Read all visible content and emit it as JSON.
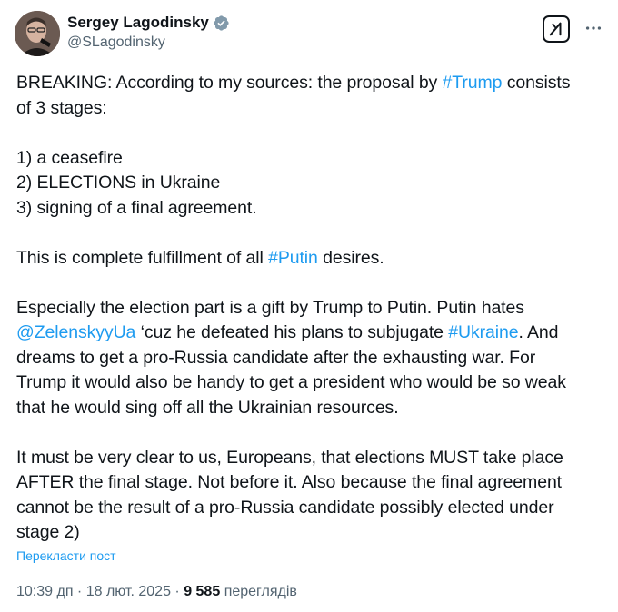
{
  "author": {
    "name": "Sergey Lagodinsky",
    "handle": "@SLagodinsky",
    "verified": true,
    "avatar_icon": "profile-photo"
  },
  "tweet": {
    "l1": {
      "a": "BREAKING: According to my sources: the proposal by ",
      "tag": "#Trump",
      "b": " consists"
    },
    "l2": "of 3 stages:",
    "l3": "1) a ceasefire",
    "l4": "2) ELECTIONS in Ukraine",
    "l5": "3) signing of a final agreement.",
    "l6": {
      "a": "This is complete fulfillment of all ",
      "tag": "#Putin",
      "b": " desires."
    },
    "l7": "Especially the election part is a gift by Trump to Putin. Putin hates",
    "l8": {
      "mention": "@ZelenskyyUa",
      "a": " ‘cuz he defeated his plans to subjugate ",
      "tag": "#Ukraine",
      "b": ". And"
    },
    "l9": "dreams to get a pro-Russia candidate after the exhausting war. For",
    "l10": "Trump it would also be handy to get a president who would be so weak",
    "l11": "that he would sing off all the Ukrainian resources.",
    "l12": "It must be very clear to us, Europeans, that elections MUST take place",
    "l13": "AFTER the final stage. Not before it. Also because the final agreement",
    "l14": "cannot be the result of a pro-Russia candidate possibly elected under",
    "l15": "stage 2)"
  },
  "translate_label": "Перекласти пост",
  "meta": {
    "time": "10:39 дп",
    "date": "18 лют. 2025",
    "sep": " · ",
    "views_count": "9 585",
    "views_label": "переглядів"
  },
  "colors": {
    "link": "#1d9bf0",
    "text": "#0f1419",
    "secondary": "#536471"
  },
  "icons": [
    "verified-badge-icon",
    "grok-icon",
    "more-options-icon"
  ]
}
